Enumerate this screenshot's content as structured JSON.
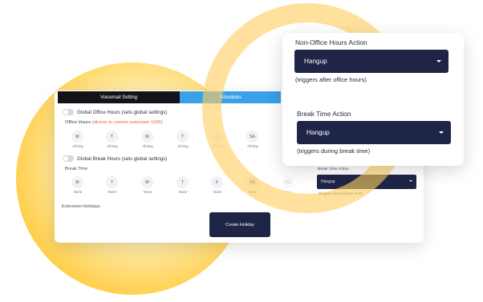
{
  "tabs": {
    "voicemail": "Voicemail Setting",
    "schedules": "Schedules"
  },
  "office": {
    "toggle_label": "Global Office Hours (sets global settings)",
    "label": "Office Hours",
    "note": "(directs to current extension 1055)",
    "days": [
      {
        "d": "M",
        "v": "All Day"
      },
      {
        "d": "T",
        "v": "All Day"
      },
      {
        "d": "W",
        "v": "All Day"
      },
      {
        "d": "T",
        "v": "All Day"
      },
      {
        "d": "F",
        "v": "All Day"
      },
      {
        "d": "SA",
        "v": "All Day"
      }
    ]
  },
  "break": {
    "toggle_label": "Global Break Hours (sets global settings)",
    "label": "Break Time",
    "days": [
      {
        "d": "M",
        "v": "None"
      },
      {
        "d": "T",
        "v": "None"
      },
      {
        "d": "W",
        "v": "None"
      },
      {
        "d": "T",
        "v": "None"
      },
      {
        "d": "F",
        "v": "None"
      },
      {
        "d": "SA",
        "v": "None"
      },
      {
        "d": "SU",
        "v": "None"
      }
    ],
    "action_label": "Break Time Action",
    "action_value": "Hangup",
    "action_note": "(triggers during break time)"
  },
  "holidays": {
    "label": "Extension Holidays",
    "create_button": "Create Holiday"
  },
  "panel": {
    "non_office_title": "Non-Office Hours Action",
    "non_office_value": "Hangup",
    "non_office_note": "(triggers after office hours)",
    "break_title": "Break Time Action",
    "break_value": "Hangup",
    "break_note": "(triggers during break time)"
  },
  "colors": {
    "navy": "#1f2547",
    "tab_active": "#111318",
    "tab_blue": "#3aa0e8",
    "accent_red": "#e25b45",
    "yellow": "#ffb300"
  }
}
